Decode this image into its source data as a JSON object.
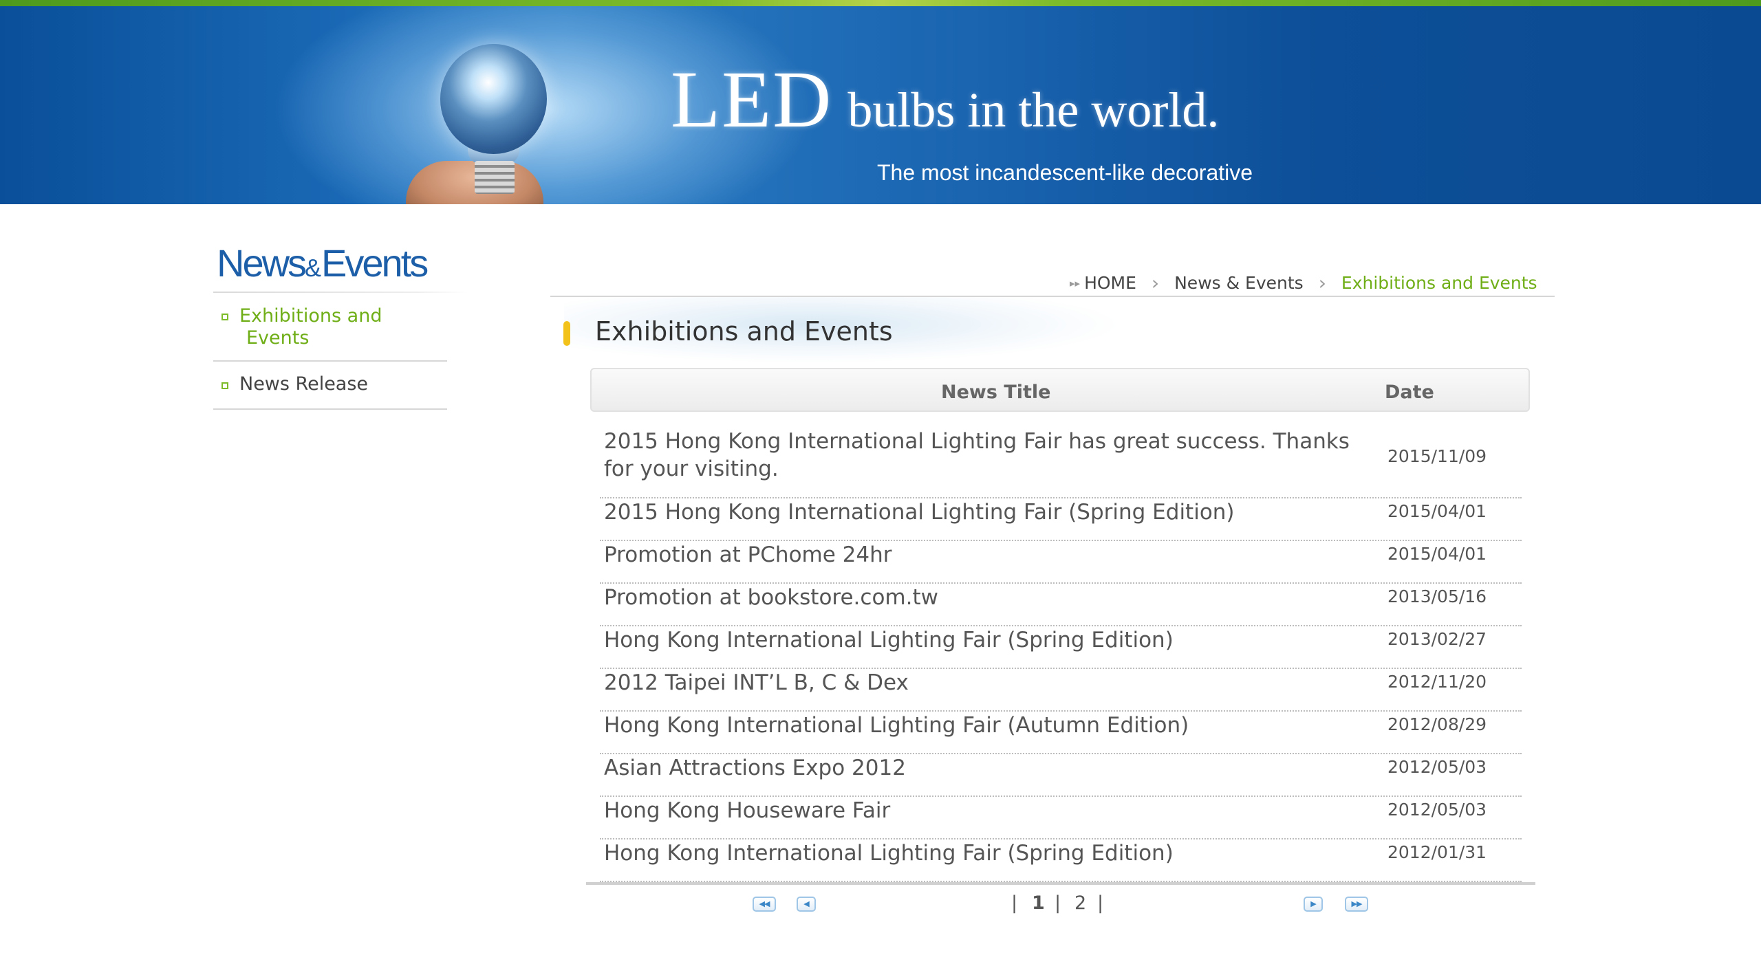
{
  "banner": {
    "headline_big": "LED",
    "headline_rest": "bulbs in the world.",
    "tagline": "The most incandescent-like decorative"
  },
  "sidebar": {
    "title_part1": "News",
    "title_amp": "&",
    "title_part2": "Events",
    "items": [
      {
        "label_line1": "Exhibitions and",
        "label_line2": "Events",
        "active": true
      },
      {
        "label_line1": "News Release",
        "active": false
      }
    ]
  },
  "breadcrumb": {
    "home": "HOME",
    "section": "News & Events",
    "current": "Exhibitions and Events"
  },
  "page_title": "Exhibitions and Events",
  "table": {
    "headers": {
      "title": "News Title",
      "date": "Date"
    },
    "rows": [
      {
        "title": "2015 Hong Kong International Lighting Fair has great success. Thanks for your visiting.",
        "date": "2015/11/09"
      },
      {
        "title": "2015 Hong Kong International Lighting Fair (Spring Edition)",
        "date": "2015/04/01"
      },
      {
        "title": "Promotion at PChome 24hr",
        "date": "2015/04/01"
      },
      {
        "title": "Promotion at bookstore.com.tw",
        "date": "2013/05/16"
      },
      {
        "title": "Hong Kong International Lighting Fair (Spring Edition)",
        "date": "2013/02/27"
      },
      {
        "title": "2012 Taipei INT’L B, C & Dex",
        "date": "2012/11/20"
      },
      {
        "title": "Hong Kong International Lighting Fair (Autumn Edition)",
        "date": "2012/08/29"
      },
      {
        "title": "Asian Attractions Expo 2012",
        "date": "2012/05/03"
      },
      {
        "title": "Hong Kong Houseware Fair",
        "date": "2012/05/03"
      },
      {
        "title": "Hong Kong International Lighting Fair (Spring Edition)",
        "date": "2012/01/31"
      }
    ]
  },
  "pagination": {
    "pages": [
      "1",
      "2"
    ],
    "current_page": "1",
    "separator": "|",
    "first_icon": "double-left-arrow-icon",
    "prev_icon": "left-arrow-icon",
    "next_icon": "right-arrow-icon",
    "last_icon": "double-right-arrow-icon"
  },
  "colors": {
    "accent_green": "#6fae17",
    "brand_blue": "#1c5fa8",
    "marker_yellow": "#f2c21b"
  }
}
